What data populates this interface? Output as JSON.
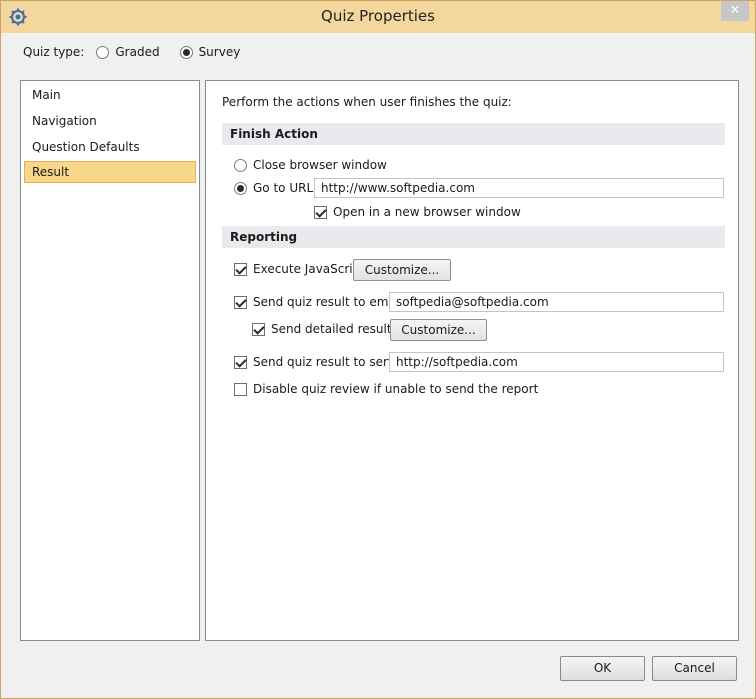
{
  "window": {
    "title": "Quiz Properties",
    "close_glyph": "✕"
  },
  "quiz_type": {
    "label": "Quiz type:",
    "options": [
      {
        "label": "Graded",
        "selected": false
      },
      {
        "label": "Survey",
        "selected": true
      }
    ]
  },
  "nav": {
    "items": [
      {
        "label": "Main",
        "selected": false
      },
      {
        "label": "Navigation",
        "selected": false
      },
      {
        "label": "Question Defaults",
        "selected": false
      },
      {
        "label": "Result",
        "selected": true
      }
    ]
  },
  "content": {
    "intro": "Perform the actions when user finishes the quiz:",
    "finish_action": {
      "heading": "Finish Action",
      "close_browser_label": "Close browser window",
      "close_browser_selected": false,
      "go_to_url_label": "Go to URL:",
      "go_to_url_selected": true,
      "url_value": "http://www.softpedia.com",
      "open_new_window_label": "Open in a new browser window",
      "open_new_window_checked": true
    },
    "reporting": {
      "heading": "Reporting",
      "execute_js_label": "Execute JavaScript",
      "execute_js_checked": true,
      "customize_label": "Customize...",
      "send_email_label": "Send quiz result to email",
      "send_email_checked": true,
      "email_value": "softpedia@softpedia.com",
      "send_detailed_label": "Send detailed results",
      "send_detailed_checked": true,
      "send_server_label": "Send quiz result to server",
      "send_server_checked": true,
      "server_value": "http://softpedia.com",
      "disable_review_label": "Disable quiz review if unable to send the report",
      "disable_review_checked": false
    }
  },
  "footer": {
    "ok_label": "OK",
    "cancel_label": "Cancel"
  }
}
